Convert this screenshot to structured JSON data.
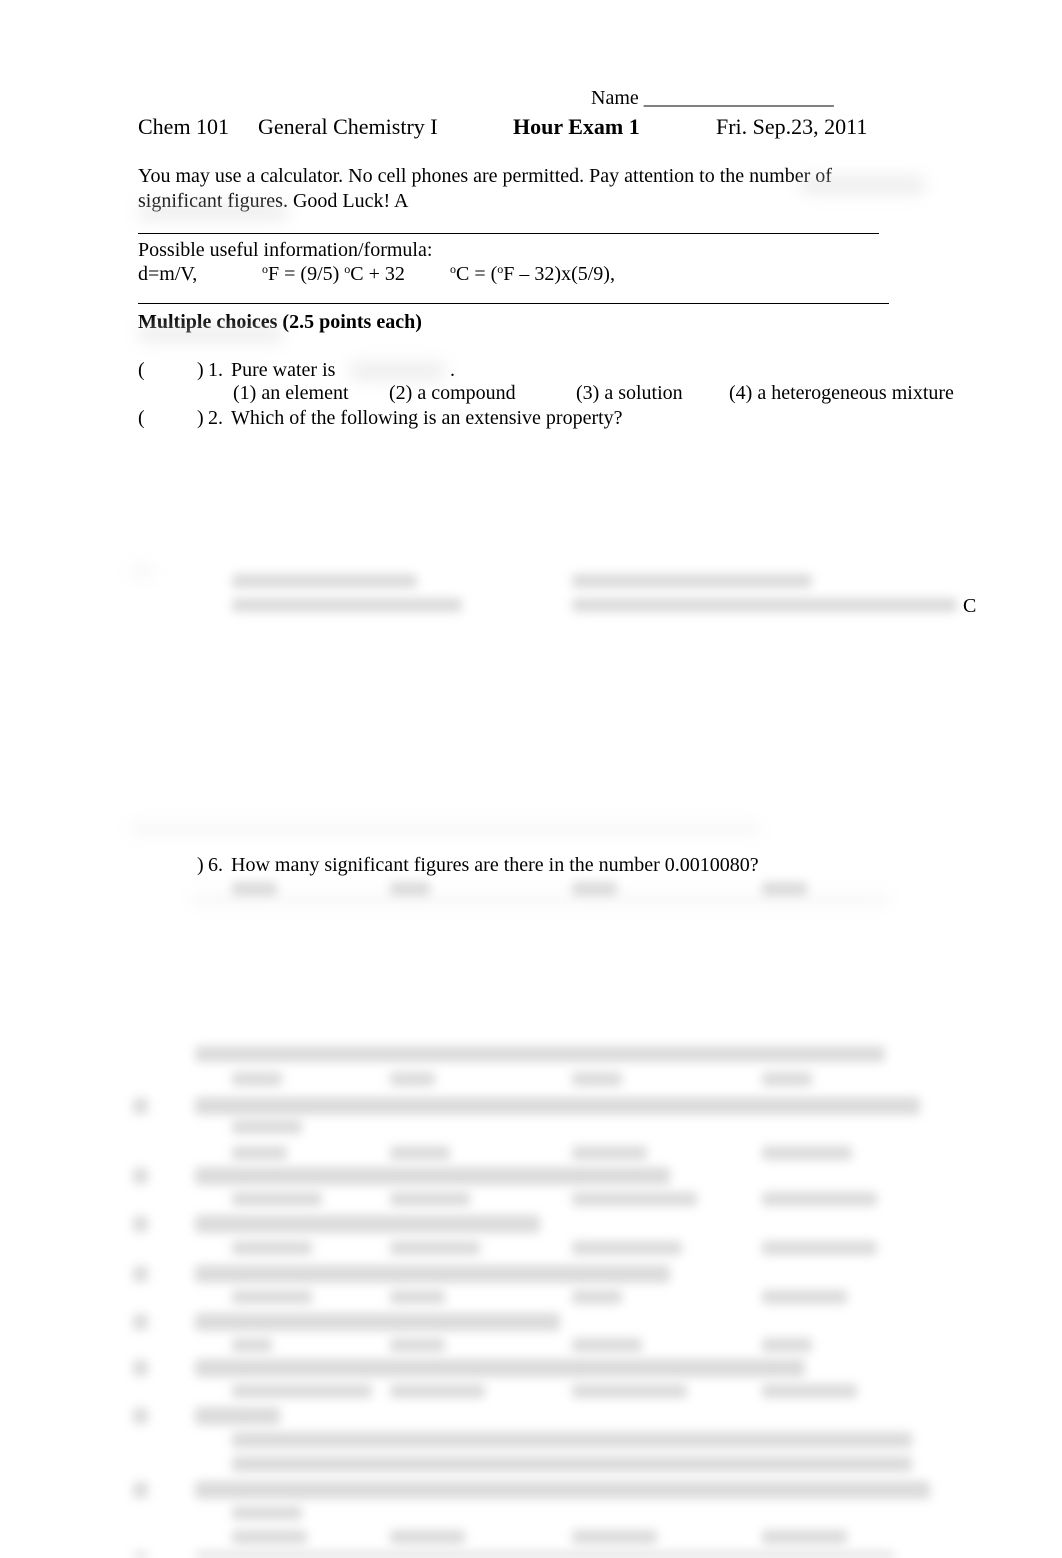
{
  "header": {
    "name_label": "Name",
    "name_blank": "___________________",
    "course": "Chem 101",
    "course_title": "General Chemistry I",
    "exam_title": "Hour Exam 1",
    "date": "Fri. Sep.23, 2011"
  },
  "instructions": {
    "line1": "You may use a calculator. No cell phones are permitted. Pay attention to the number of",
    "line2": "significant figures. Good Luck! A"
  },
  "formulas": {
    "heading": "Possible useful information/formula:",
    "density": "d=m/V,",
    "f_to_c_deg1": "o",
    "f_to_c_part1": "F = (9/5) ",
    "f_to_c_deg2": "o",
    "f_to_c_part2": "C + 32",
    "c_to_f_deg1": "o",
    "c_to_f_part1": "C = (",
    "c_to_f_deg2": "o",
    "c_to_f_part2": "F – 32)x(5/9),"
  },
  "section": {
    "title": "Multiple choices (2.5 points each)"
  },
  "questions": [
    {
      "paren_open": "(",
      "paren_close": ")",
      "number": "1.",
      "text": "Pure water is",
      "trailing": ".",
      "choices": [
        "(1) an element",
        "(2) a compound",
        "(3) a solution",
        "(4) a heterogeneous mixture"
      ]
    },
    {
      "paren_open": "(",
      "paren_close": ")",
      "number": "2.",
      "text": "Which of the following is an extensive property?"
    },
    {
      "fragment": "C"
    },
    {
      "paren_close": ")",
      "number": "6.",
      "text": "How many significant figures are there in the number 0.0010080?"
    }
  ]
}
